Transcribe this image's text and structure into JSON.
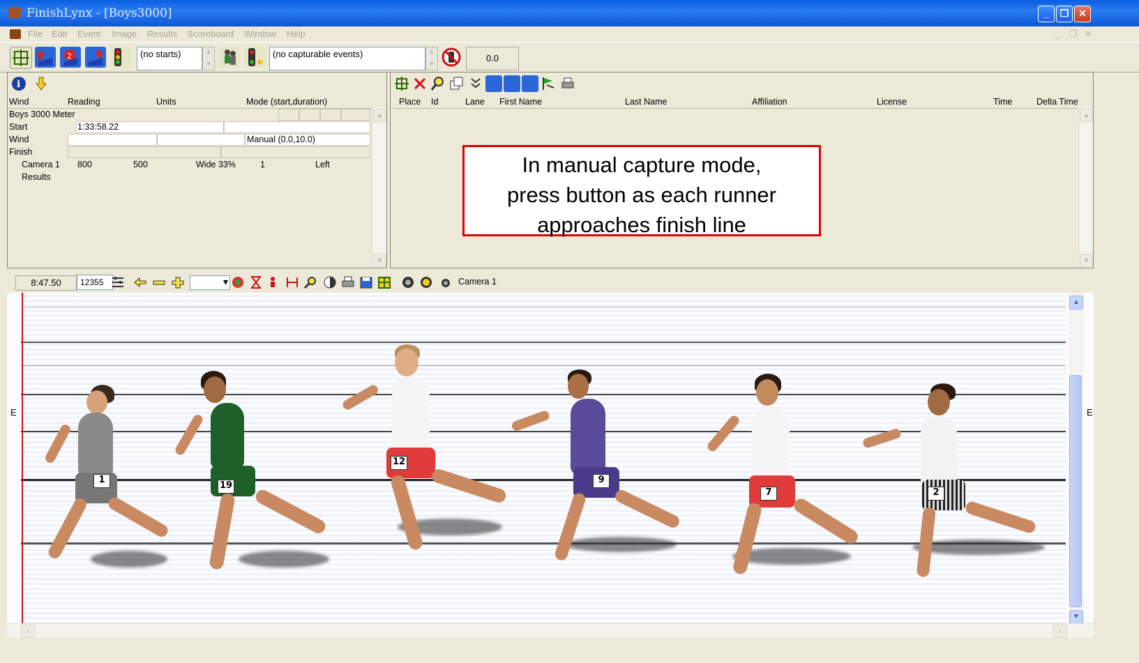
{
  "window": {
    "title": "FinishLynx - [Boys3000]"
  },
  "menu": [
    "File",
    "Edit",
    "Event",
    "Image",
    "Results",
    "Scoreboard",
    "Window",
    "Help"
  ],
  "toolbar": {
    "starts_combo": "(no starts)",
    "events_combo": "(no capturable events)",
    "counter": "0.0"
  },
  "event_panel": {
    "columns": [
      "Wind",
      "Reading",
      "Units",
      "Mode (start,duration)"
    ],
    "event_name": "Boys 3000 Meter",
    "start_label": "Start",
    "start_time": "1:33:58.22",
    "wind_label": "Wind",
    "wind_mode": "Manual (0.0,10.0)",
    "finish_label": "Finish",
    "camera_row": [
      "Camera 1",
      "800",
      "500",
      "Wide 33%",
      "1",
      "Left"
    ],
    "results_label": "Results"
  },
  "results_panel": {
    "columns": [
      "Place",
      "Id",
      "Lane",
      "First Name",
      "Last Name",
      "Affiliation",
      "License",
      "Time",
      "Delta Time"
    ]
  },
  "annotation": {
    "line1": "In manual capture mode,",
    "line2": "press button as each runner",
    "line3": "approaches finish line"
  },
  "image_toolbar": {
    "time": "8:47.50",
    "frame": "12355",
    "camera": "Camera 1"
  },
  "photo": {
    "edge_label_left": "E",
    "edge_label_right": "E",
    "bibs": [
      "1",
      "19",
      "12",
      "9",
      "7",
      "2"
    ]
  },
  "colors": {
    "titlebar": "#0a5fe0",
    "annotation_border": "#e00000",
    "finish_line": "#d01010"
  }
}
